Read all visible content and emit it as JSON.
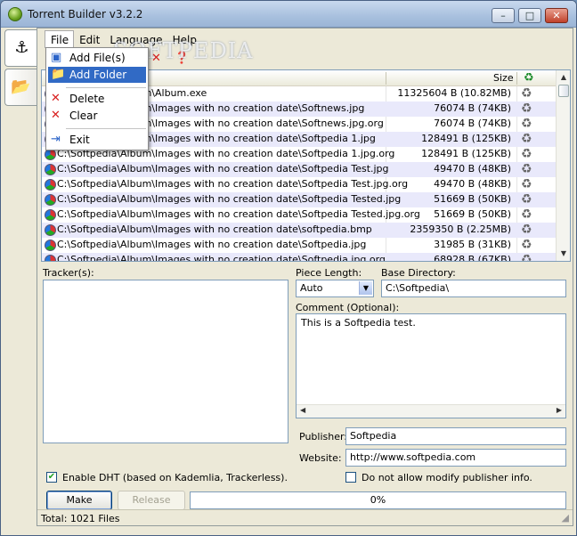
{
  "window": {
    "title": "Torrent Builder v3.2.2",
    "minimize": "–",
    "maximize": "□",
    "close": "✕"
  },
  "menu": [
    {
      "label": "File"
    },
    {
      "label": "Edit"
    },
    {
      "label": "Language"
    },
    {
      "label": "Help"
    }
  ],
  "file_menu": {
    "add_files": "Add File(s)",
    "add_folder": "Add Folder",
    "delete": "Delete",
    "clear": "Clear",
    "exit": "Exit"
  },
  "watermark": "SOFTPEDIA",
  "files": {
    "size_header": "Size",
    "rows": [
      {
        "path": "C:\\Softpedia\\Album\\Album.exe",
        "size": "11325604 B (10.82MB)"
      },
      {
        "path": "C:\\Softpedia\\Album\\Images with no creation date\\Softnews.jpg",
        "size": "76074 B (74KB)"
      },
      {
        "path": "C:\\Softpedia\\Album\\Images with no creation date\\Softnews.jpg.org",
        "size": "76074 B (74KB)"
      },
      {
        "path": "C:\\Softpedia\\Album\\Images with no creation date\\Softpedia 1.jpg",
        "size": "128491 B (125KB)"
      },
      {
        "path": "C:\\Softpedia\\Album\\Images with no creation date\\Softpedia 1.jpg.org",
        "size": "128491 B (125KB)"
      },
      {
        "path": "C:\\Softpedia\\Album\\Images with no creation date\\Softpedia Test.jpg",
        "size": "49470 B (48KB)"
      },
      {
        "path": "C:\\Softpedia\\Album\\Images with no creation date\\Softpedia Test.jpg.org",
        "size": "49470 B (48KB)"
      },
      {
        "path": "C:\\Softpedia\\Album\\Images with no creation date\\Softpedia Tested.jpg",
        "size": "51669 B (50KB)"
      },
      {
        "path": "C:\\Softpedia\\Album\\Images with no creation date\\Softpedia Tested.jpg.org",
        "size": "51669 B (50KB)"
      },
      {
        "path": "C:\\Softpedia\\Album\\Images with no creation date\\softpedia.bmp",
        "size": "2359350 B (2.25MB)"
      },
      {
        "path": "C:\\Softpedia\\Album\\Images with no creation date\\Softpedia.jpg",
        "size": "31985 B (31KB)"
      },
      {
        "path": "C:\\Softpedia\\Album\\Images with no creation date\\Softpedia.jpg.org",
        "size": "68928 B (67KB)"
      }
    ]
  },
  "tracker": {
    "label": "Tracker(s):"
  },
  "piece_length": {
    "label": "Piece Length:",
    "value": "Auto"
  },
  "base_directory": {
    "label": "Base Directory:",
    "value": "C:\\Softpedia\\"
  },
  "comment": {
    "label": "Comment (Optional):",
    "value": "This is a Softpedia test."
  },
  "publisher": {
    "label": "Publisher:",
    "value": "Softpedia"
  },
  "website": {
    "label": "Website:",
    "value": "http://www.softpedia.com"
  },
  "options": {
    "enable_dht": "Enable DHT (based on Kademlia, Trackerless).",
    "enable_dht_checked": true,
    "no_modify_publisher": "Do not allow modify publisher info.",
    "no_modify_publisher_checked": false
  },
  "actions": {
    "make": "Make",
    "release": "Release"
  },
  "progress": {
    "text": "0%",
    "value": 0
  },
  "status": {
    "total": "Total: 1021 Files"
  },
  "colors": {
    "selection": "#316ac5",
    "row_alt": "#e9e9fb",
    "border": "#7f9db9"
  }
}
